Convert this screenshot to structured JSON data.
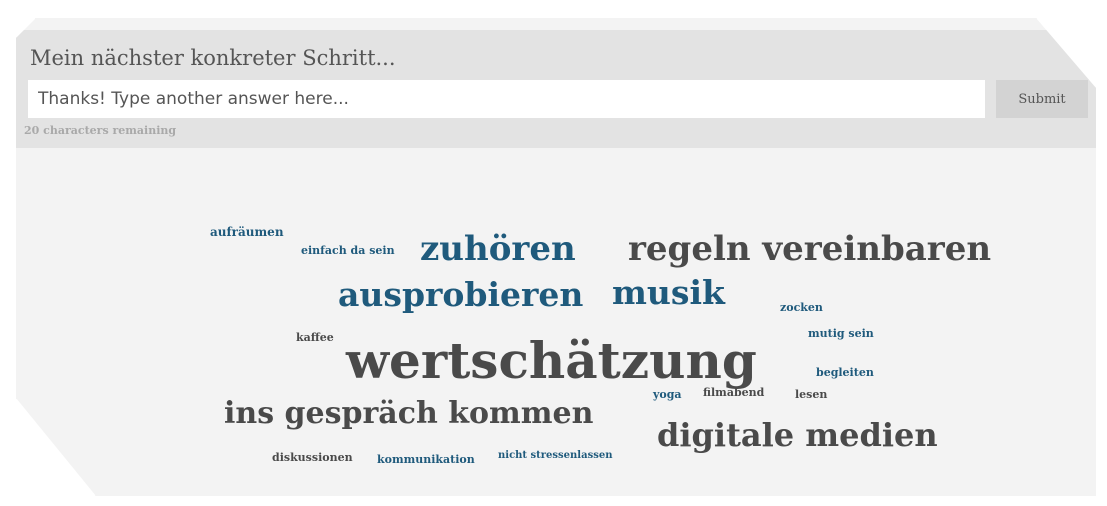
{
  "widget": {
    "title": "Mein nächster konkreter Schritt...",
    "input_placeholder": "Thanks! Type another answer here...",
    "submit_label": "Submit",
    "chars_remaining": "20 characters remaining"
  },
  "colors": {
    "blue_word": "#1f5a7c",
    "gray_word": "#4a4a4a",
    "header_bg": "#e3e3e3",
    "cloud_bg": "#f3f3f3"
  },
  "word_cloud": [
    {
      "text": "aufräumen",
      "color": "blue"
    },
    {
      "text": "einfach da sein",
      "color": "blue"
    },
    {
      "text": "zuhören",
      "color": "blue"
    },
    {
      "text": "regeln vereinbaren",
      "color": "gray"
    },
    {
      "text": "ausprobieren",
      "color": "blue"
    },
    {
      "text": "musik",
      "color": "blue"
    },
    {
      "text": "zocken",
      "color": "blue"
    },
    {
      "text": "mutig sein",
      "color": "blue"
    },
    {
      "text": "kaffee",
      "color": "gray"
    },
    {
      "text": "wertschätzung",
      "color": "gray"
    },
    {
      "text": "begleiten",
      "color": "blue"
    },
    {
      "text": "yoga",
      "color": "blue"
    },
    {
      "text": "filmabend",
      "color": "gray"
    },
    {
      "text": "lesen",
      "color": "gray"
    },
    {
      "text": "ins gespräch kommen",
      "color": "gray"
    },
    {
      "text": "digitale medien",
      "color": "gray"
    },
    {
      "text": "diskussionen",
      "color": "gray"
    },
    {
      "text": "kommunikation",
      "color": "blue"
    },
    {
      "text": "nicht stressenlassen",
      "color": "blue"
    }
  ]
}
